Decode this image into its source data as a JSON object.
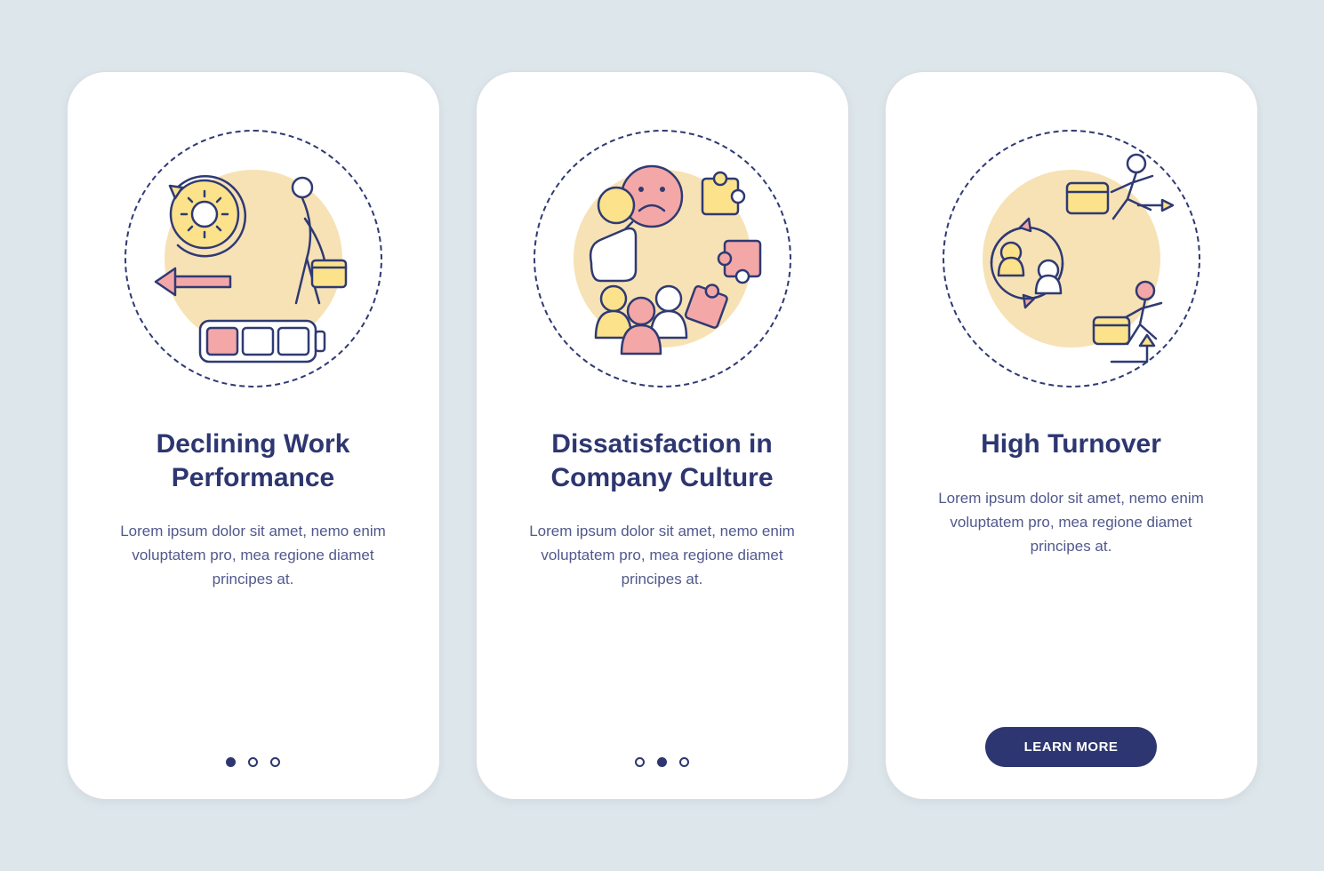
{
  "colors": {
    "primary": "#2d3670",
    "accent_yellow": "#fbe28b",
    "accent_red": "#f3a7a7",
    "bg": "#dde7eb"
  },
  "cards": [
    {
      "title": "Declining Work Performance",
      "body": "Lorem ipsum dolor sit amet, nemo enim voluptatem pro, mea regione diamet principes at.",
      "icon": "declining-performance-icon",
      "page_indicator_active": 0,
      "has_cta": false
    },
    {
      "title": "Dissatisfaction in Company Culture",
      "body": "Lorem ipsum dolor sit amet, nemo enim voluptatem pro, mea regione diamet principes at.",
      "icon": "dissatisfaction-icon",
      "page_indicator_active": 1,
      "has_cta": false
    },
    {
      "title": "High Turnover",
      "body": "Lorem ipsum dolor sit amet, nemo enim voluptatem pro, mea regione diamet principes at.",
      "icon": "high-turnover-icon",
      "page_indicator_active": 2,
      "has_cta": true,
      "cta_label": "LEARN MORE"
    }
  ],
  "page_indicator_count": 3
}
